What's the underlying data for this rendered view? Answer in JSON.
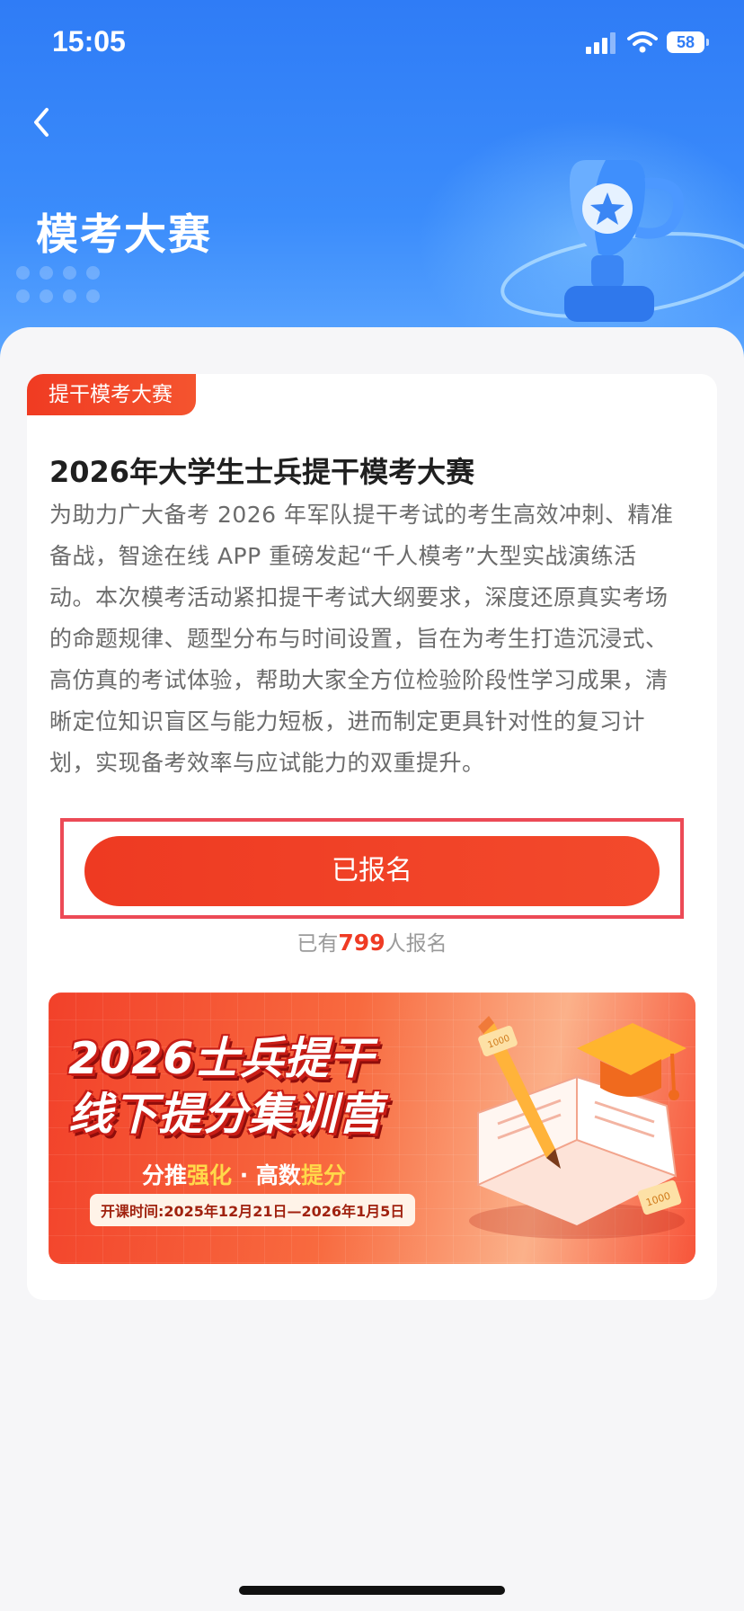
{
  "status_bar": {
    "time": "15:05",
    "battery": "58"
  },
  "header": {
    "title": "模考大赛"
  },
  "card": {
    "tag": "提干模考大赛",
    "title": "2026年大学生士兵提干模考大赛",
    "description_lines": [
      "为助力广大备考 2026 年军队提干考试的考生高效冲刺、精准",
      "备战，智途在线 APP 重磅发起“千人模考”大型实战演练活",
      "动。本次模考活动紧扣提干考试大纲要求，深度还原真实考场",
      "的命题规律、题型分布与时间设置，旨在为考生打造沉浸式、",
      "高仿真的考试体验，帮助大家全方位检验阶段性学习成果，清",
      "晰定位知识盲区与能力短板，进而制定更具针对性的复习计",
      "划，实现备考效率与应试能力的双重提升。"
    ],
    "button_label": "已报名",
    "count_prefix": "已有",
    "count_number": "799",
    "count_suffix": "人报名"
  },
  "banner": {
    "title_line1": "2026士兵提干",
    "title_line2": "线下提分集训营",
    "sub_part1": "分推",
    "sub_part2": "强化",
    "sub_part3": " · 高数",
    "sub_part4": "提分",
    "date_text": "开课时间:2025年12月21日—2026年1月5日",
    "coin_label": "1000"
  },
  "colors": {
    "header_blue": "#2f7cf6",
    "accent_red": "#ee3a22",
    "highlight_border": "#ec4a56"
  }
}
